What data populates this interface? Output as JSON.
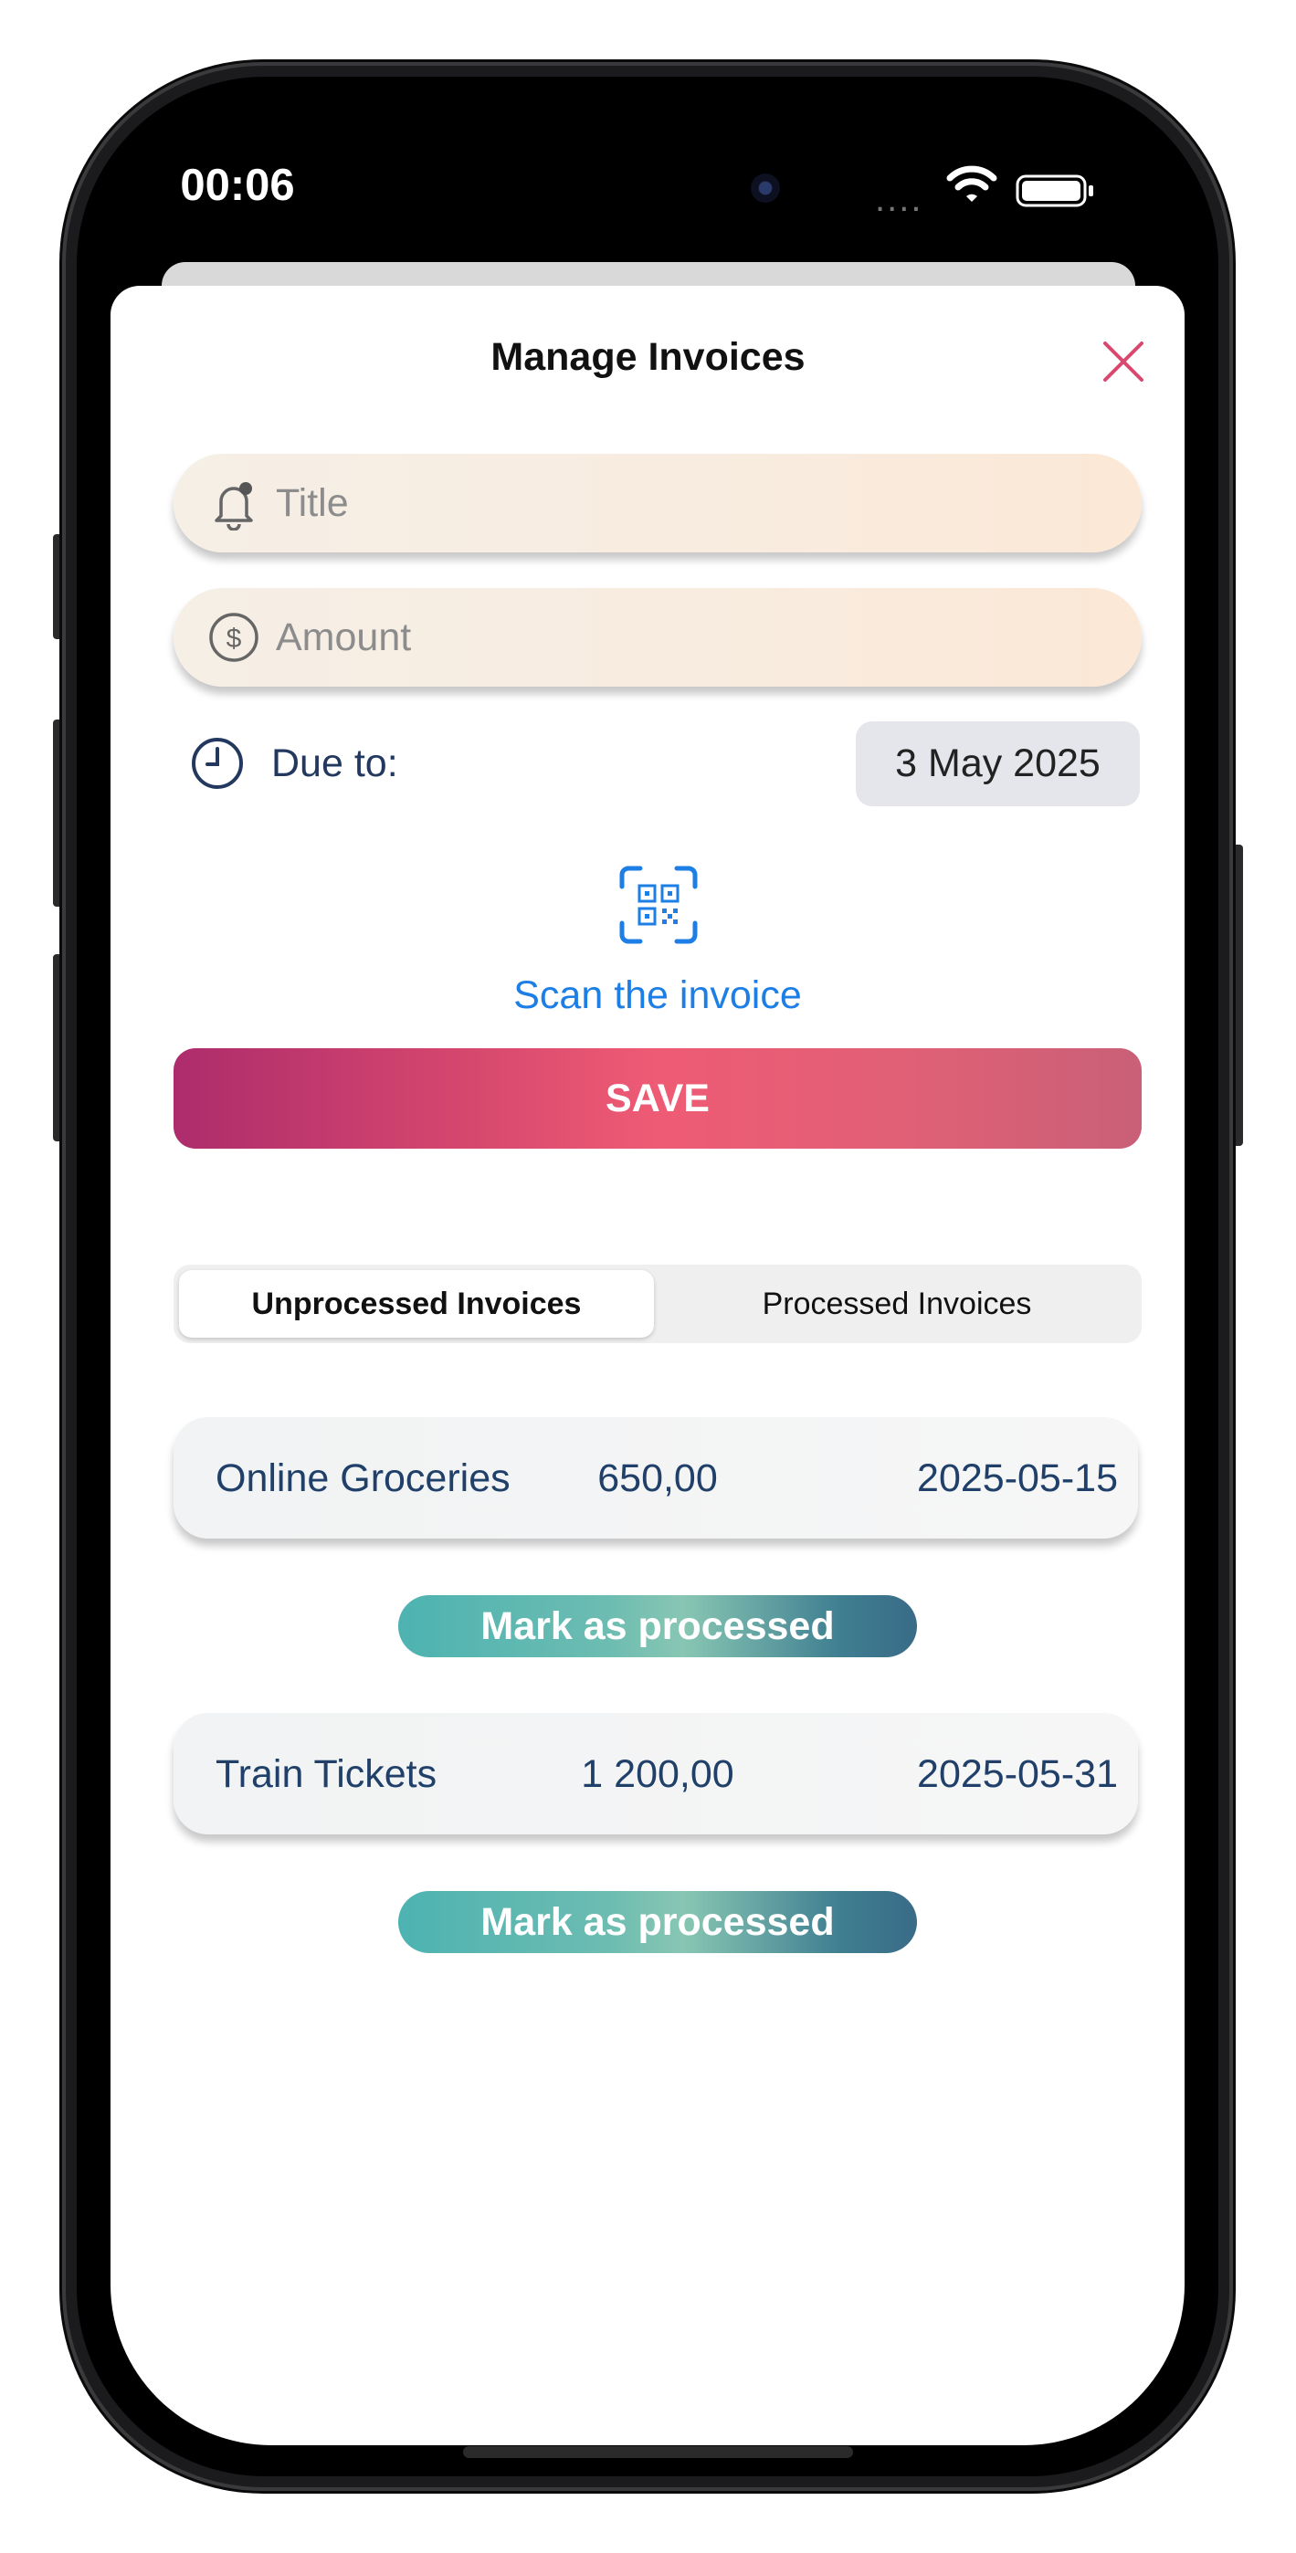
{
  "status_bar": {
    "time": "00:06",
    "signal_dots": "....",
    "icons": [
      "wifi-icon",
      "battery-icon"
    ]
  },
  "sheet": {
    "title": "Manage Invoices",
    "close_icon": "close-icon",
    "accent_color": "#d9486f"
  },
  "form": {
    "title_placeholder": "Title",
    "title_icon": "bell-icon",
    "amount_placeholder": "Amount",
    "amount_icon": "dollar-circle-icon",
    "due_label": "Due to:",
    "due_icon": "clock-icon",
    "due_date": "3 May 2025",
    "scan_label": "Scan the invoice",
    "scan_icon": "qr-scan-icon",
    "save_label": "SAVE"
  },
  "tabs": [
    {
      "label": "Unprocessed Invoices",
      "selected": true
    },
    {
      "label": "Processed Invoices",
      "selected": false
    }
  ],
  "invoices": [
    {
      "title": "Online Groceries",
      "amount": "650,00",
      "date": "2025-05-15",
      "action": "Mark as processed"
    },
    {
      "title": "Train Tickets",
      "amount": "1 200,00",
      "date": "2025-05-31",
      "action": "Mark as processed"
    }
  ],
  "colors": {
    "save_gradient": [
      "#ad2c6c",
      "#ee5b74",
      "#c96077"
    ],
    "mark_gradient": [
      "#4db3b1",
      "#88c6b3",
      "#3a6b87"
    ],
    "link_blue": "#1d7fe6",
    "text_navy": "#20406a",
    "field_beige": "#f8ece0"
  }
}
